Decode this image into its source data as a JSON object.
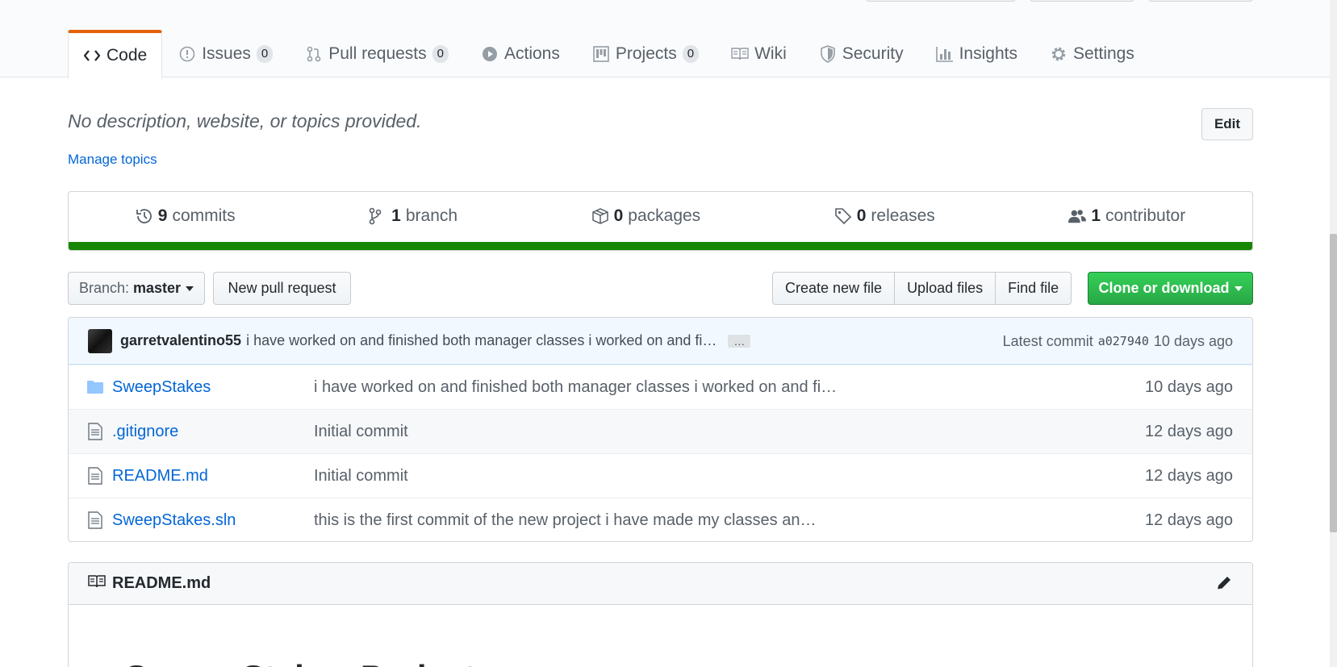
{
  "repo_nav": {
    "tabs": [
      {
        "label": "Code",
        "icon": "code-icon",
        "counter": null,
        "selected": true
      },
      {
        "label": "Issues",
        "icon": "issue-opened-icon",
        "counter": "0"
      },
      {
        "label": "Pull requests",
        "icon": "git-pull-request-icon",
        "counter": "0"
      },
      {
        "label": "Actions",
        "icon": "play-icon",
        "counter": null
      },
      {
        "label": "Projects",
        "icon": "project-icon",
        "counter": "0"
      },
      {
        "label": "Wiki",
        "icon": "book-icon",
        "counter": null
      },
      {
        "label": "Security",
        "icon": "shield-icon",
        "counter": null
      },
      {
        "label": "Insights",
        "icon": "graph-icon",
        "counter": null
      },
      {
        "label": "Settings",
        "icon": "gear-icon",
        "counter": null
      }
    ]
  },
  "about": {
    "description": "No description, website, or topics provided.",
    "manage_topics": "Manage topics",
    "edit_label": "Edit"
  },
  "summary": {
    "commits": {
      "count": "9",
      "label": "commits"
    },
    "branches": {
      "count": "1",
      "label": "branch"
    },
    "packages": {
      "count": "0",
      "label": "packages"
    },
    "releases": {
      "count": "0",
      "label": "releases"
    },
    "contributors": {
      "count": "1",
      "label": "contributor"
    },
    "language_color": "#178600"
  },
  "toolbar": {
    "branch_prefix": "Branch:",
    "branch_name": "master",
    "new_pull_request": "New pull request",
    "create_new_file": "Create new file",
    "upload_files": "Upload files",
    "find_file": "Find file",
    "clone_or_download": "Clone or download"
  },
  "latest_commit": {
    "author": "garretvalentino55",
    "message": "i have worked on and finished both manager classes i worked on and fi…",
    "ellipsis": "…",
    "label": "Latest commit",
    "sha": "a027940",
    "age": "10 days ago"
  },
  "files": [
    {
      "name": "SweepStakes",
      "type": "folder",
      "message": "i have worked on and finished both manager classes i worked on and fi…",
      "age": "10 days ago"
    },
    {
      "name": ".gitignore",
      "type": "file",
      "message": "Initial commit",
      "age": "12 days ago"
    },
    {
      "name": "README.md",
      "type": "file",
      "message": "Initial commit",
      "age": "12 days ago"
    },
    {
      "name": "SweepStakes.sln",
      "type": "file",
      "message": "this is the first commit of the new project i have made my classes an…",
      "age": "12 days ago"
    }
  ],
  "readme": {
    "filename": "README.md",
    "title_partial": "Sweep Stakes Project"
  }
}
